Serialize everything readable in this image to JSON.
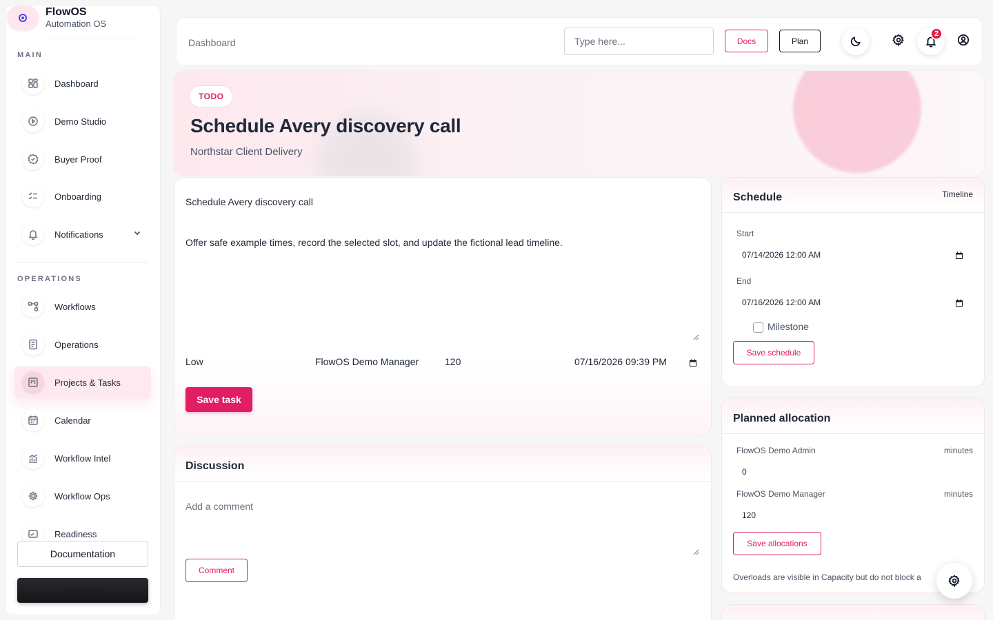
{
  "brand": {
    "name": "FlowOS",
    "subtitle": "Automation OS"
  },
  "sidebar": {
    "main_title": "MAIN",
    "main_items": [
      {
        "label": "Dashboard",
        "icon": "grid-icon"
      },
      {
        "label": "Demo Studio",
        "icon": "play-circle-icon"
      },
      {
        "label": "Buyer Proof",
        "icon": "check-badge-icon"
      },
      {
        "label": "Onboarding",
        "icon": "checklist-icon"
      },
      {
        "label": "Notifications",
        "icon": "bell-icon"
      }
    ],
    "ops_title": "OPERATIONS",
    "ops_items": [
      {
        "label": "Workflows",
        "icon": "workflow-icon"
      },
      {
        "label": "Operations",
        "icon": "document-icon"
      },
      {
        "label": "Projects & Tasks",
        "icon": "kanban-icon",
        "active": true
      },
      {
        "label": "Calendar",
        "icon": "calendar-icon"
      },
      {
        "label": "Workflow Intel",
        "icon": "chart-icon"
      },
      {
        "label": "Workflow Ops",
        "icon": "gear-icon"
      },
      {
        "label": "Readiness",
        "icon": "readiness-icon"
      }
    ],
    "documentation_label": "Documentation",
    "logout_label": "Logout"
  },
  "topbar": {
    "breadcrumb": "Dashboard",
    "search_placeholder": "Type here...",
    "docs_label": "Docs",
    "plan_label": "Plan",
    "notification_count": "2"
  },
  "hero": {
    "status": "TODO",
    "title": "Schedule Avery discovery call",
    "project": "Northstar Client Delivery"
  },
  "task": {
    "title": "Schedule Avery discovery call",
    "description": "Offer safe example times, record the selected slot, and update the fictional lead timeline.",
    "priority": "Low",
    "assignee": "FlowOS Demo Manager",
    "estimate": "120",
    "due": "07/16/2026 09:39  PM",
    "save_label": "Save task"
  },
  "discussion": {
    "title": "Discussion",
    "placeholder": "Add a comment",
    "comment_label": "Comment"
  },
  "schedule": {
    "title": "Schedule",
    "timeline_label": "Timeline",
    "start_label": "Start",
    "start_value": "07/14/2026 12:00  AM",
    "end_label": "End",
    "end_value": "07/16/2026 12:00  AM",
    "milestone_label": "Milestone",
    "save_label": "Save schedule"
  },
  "allocation": {
    "title": "Planned allocation",
    "rows": [
      {
        "name": "FlowOS Demo Admin",
        "unit": "minutes",
        "value": "0"
      },
      {
        "name": "FlowOS Demo Manager",
        "unit": "minutes",
        "value": "120"
      }
    ],
    "save_label": "Save allocations",
    "note": "Overloads are visible in Capacity but do not block a"
  },
  "colors": {
    "accent": "#e11d63",
    "accent_soft": "#fde9ef",
    "text": "#1f2937"
  }
}
